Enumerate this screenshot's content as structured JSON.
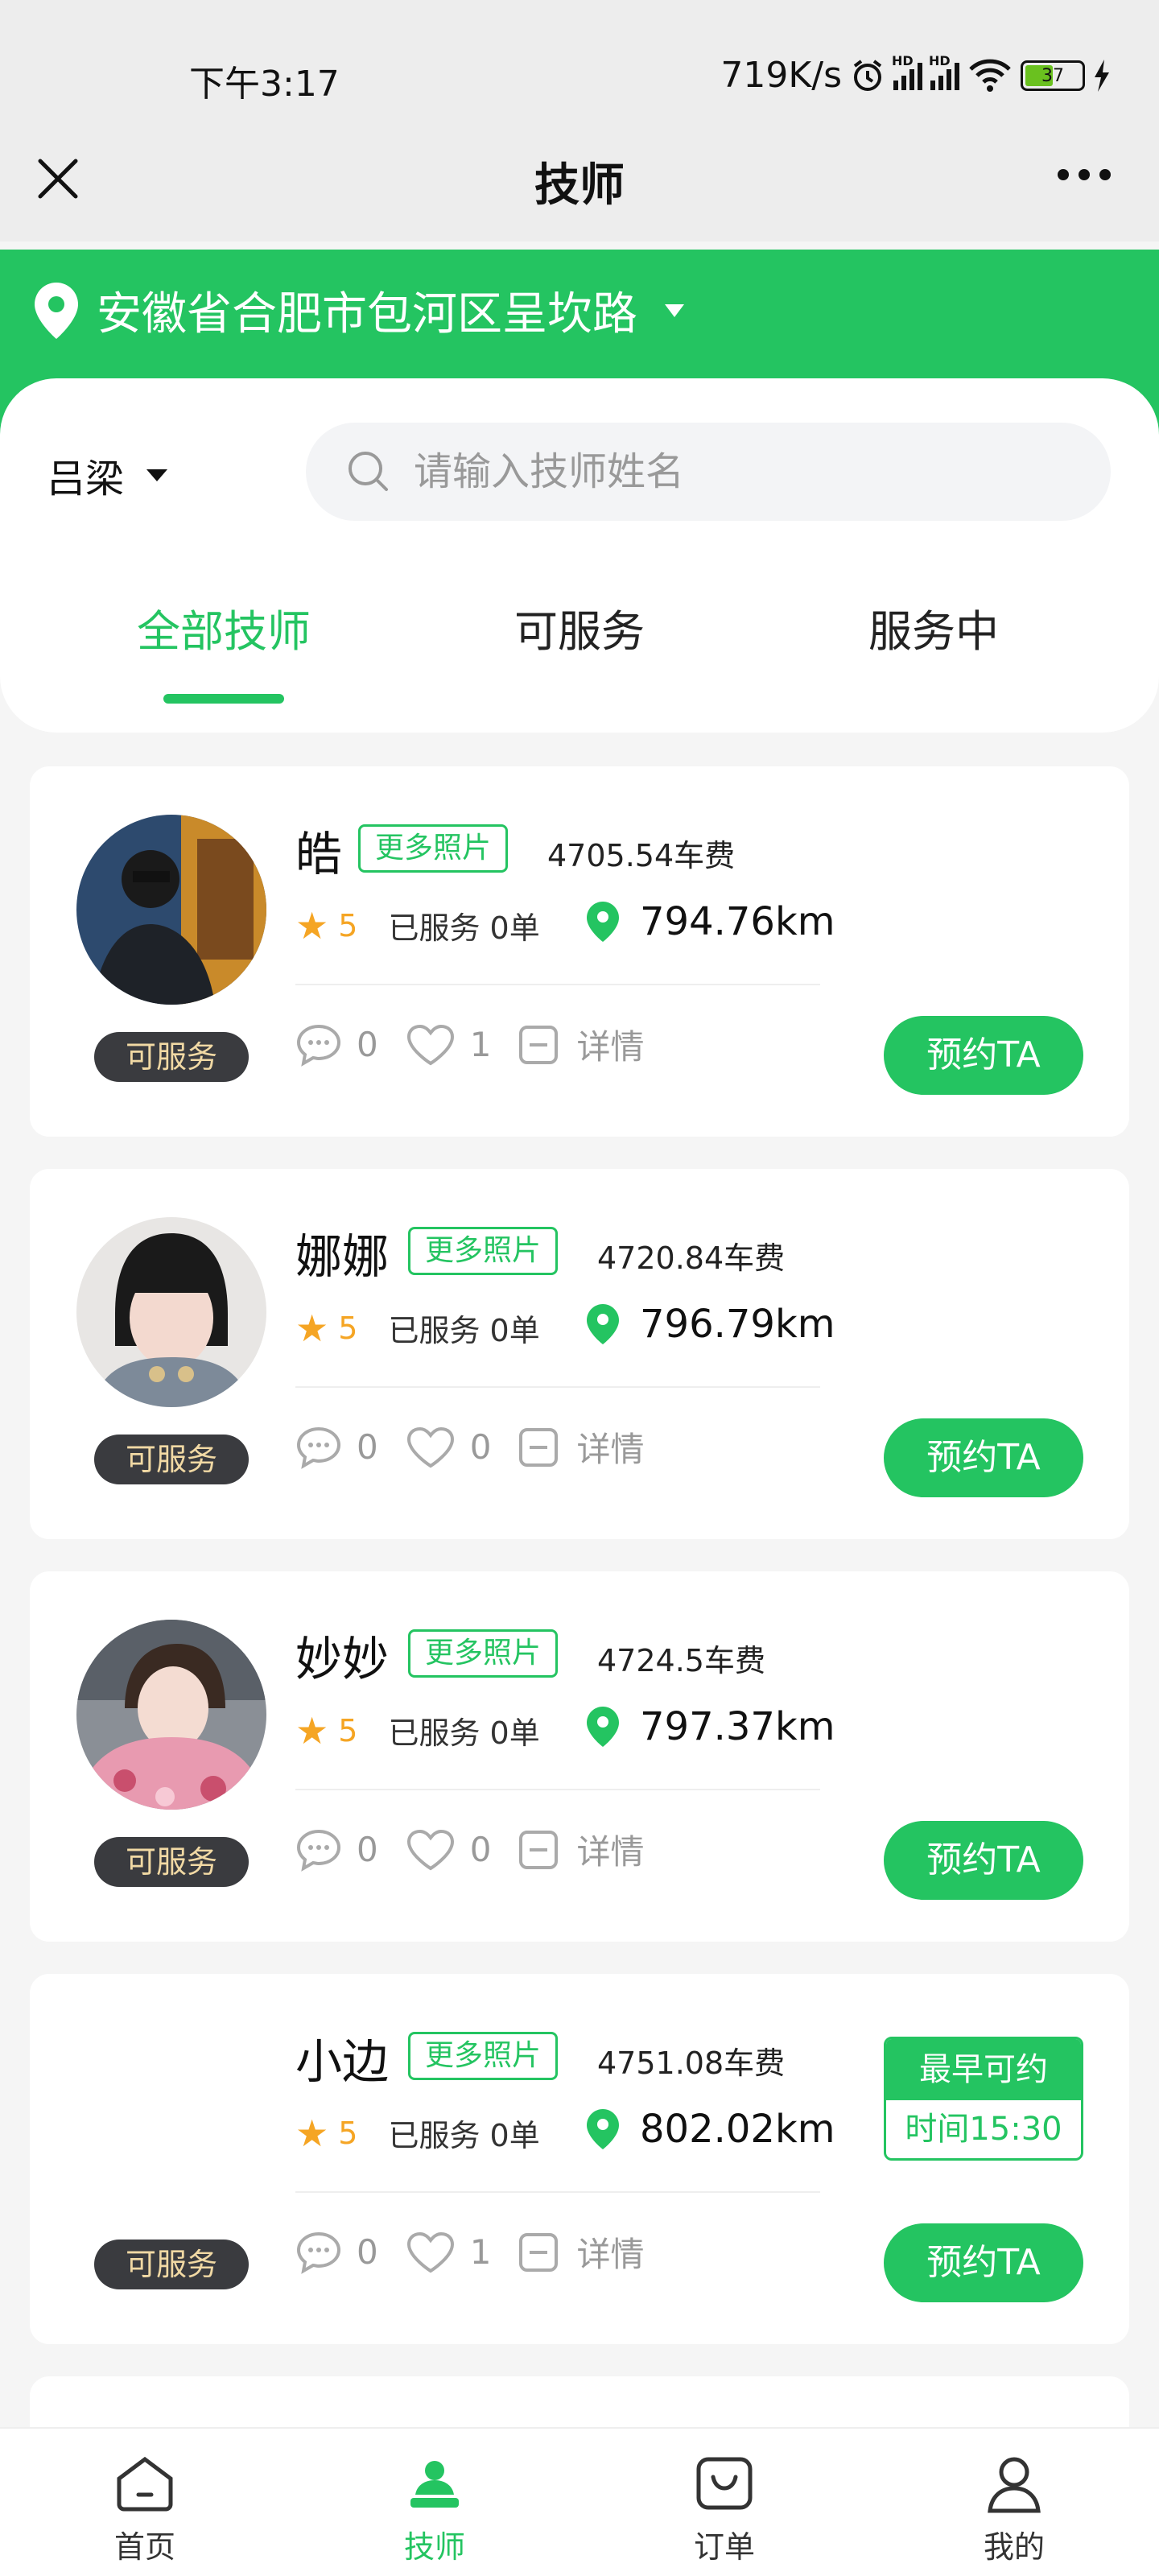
{
  "status_bar": {
    "time": "下午3:17",
    "speed": "719K/s",
    "hd1": "HD",
    "hd2": "HD",
    "battery": "37"
  },
  "header": {
    "title": "技师"
  },
  "location": {
    "address": "安徽省合肥市包河区呈坎路"
  },
  "filter": {
    "city": "吕梁",
    "search_placeholder": "请输入技师姓名"
  },
  "tabs": [
    {
      "label": "全部技师",
      "active": true
    },
    {
      "label": "可服务",
      "active": false
    },
    {
      "label": "服务中",
      "active": false
    }
  ],
  "technicians": [
    {
      "name": "皓",
      "more_photos": "更多照片",
      "fee": "4705.54车费",
      "rating": "5",
      "served": "已服务 0单",
      "distance": "794.76km",
      "comments": "0",
      "likes": "1",
      "detail": "详情",
      "status": "可服务",
      "book": "预约TA"
    },
    {
      "name": "娜娜",
      "more_photos": "更多照片",
      "fee": "4720.84车费",
      "rating": "5",
      "served": "已服务 0单",
      "distance": "796.79km",
      "comments": "0",
      "likes": "0",
      "detail": "详情",
      "status": "可服务",
      "book": "预约TA"
    },
    {
      "name": "妙妙",
      "more_photos": "更多照片",
      "fee": "4724.5车费",
      "rating": "5",
      "served": "已服务 0单",
      "distance": "797.37km",
      "comments": "0",
      "likes": "0",
      "detail": "详情",
      "status": "可服务",
      "book": "预约TA"
    },
    {
      "name": "小边",
      "more_photos": "更多照片",
      "fee": "4751.08车费",
      "rating": "5",
      "served": "已服务 0单",
      "distance": "802.02km",
      "comments": "0",
      "likes": "1",
      "detail": "详情",
      "status": "可服务",
      "book": "预约TA",
      "earliest_label": "最早可约",
      "earliest_time": "时间15:30"
    }
  ],
  "bottom_nav": [
    {
      "label": "首页",
      "icon": "home-icon"
    },
    {
      "label": "技师",
      "icon": "technician-icon",
      "active": true
    },
    {
      "label": "订单",
      "icon": "order-bag-icon"
    },
    {
      "label": "我的",
      "icon": "profile-icon"
    }
  ],
  "colors": {
    "accent": "#24c461",
    "pill_bg": "#3a3b3f",
    "pill_text": "#f1d9a4",
    "star": "#f5a524"
  }
}
